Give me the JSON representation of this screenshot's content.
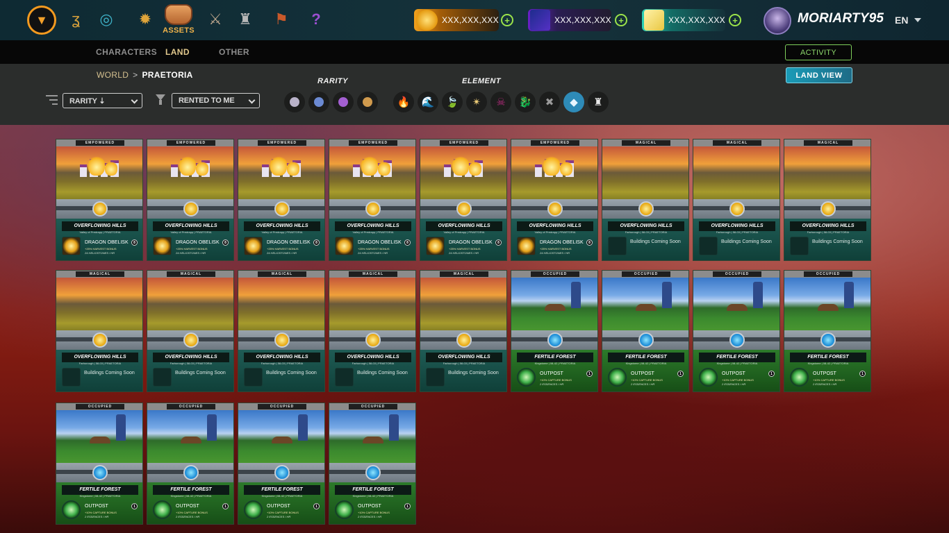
{
  "header": {
    "nav_icons": [
      "battle-icon",
      "scroll-icon",
      "vortex-icon",
      "compass-icon",
      "assets-icon",
      "sword-icon",
      "castle-icon",
      "banner-icon",
      "help-icon"
    ],
    "assets_label": "ASSETS",
    "currencies": [
      {
        "name": "coin",
        "value": "XXX,XXX,XXX",
        "color": "#f0a21b"
      },
      {
        "name": "purple-gem",
        "value": "XXX,XXX,XXX",
        "color": "#7a2ad9"
      },
      {
        "name": "credits",
        "value": "XXX,XXX,XXX",
        "color": "#27b7a9"
      }
    ],
    "username": "MORIARTY95",
    "language": "EN"
  },
  "tabs": [
    {
      "label": "CHARACTERS",
      "active": false
    },
    {
      "label": "LAND",
      "active": true
    },
    {
      "label": "OTHER",
      "active": false
    }
  ],
  "activity_label": "ACTIVITY",
  "breadcrumb": {
    "root": "WORLD",
    "separator": ">",
    "current": "PRAETORIA"
  },
  "land_view_label": "LAND VIEW",
  "filters": {
    "sort_value": "RARITY ⇣",
    "ownership_value": "RENTED TO ME",
    "rarity_label": "RARITY",
    "element_label": "ELEMENT",
    "rarity_colors": [
      "#b9b2c9",
      "#6b8ad3",
      "#a35fd1",
      "#d09a4d"
    ],
    "element_glyphs": [
      {
        "name": "fire-element-icon",
        "glyph": "🔥",
        "active": false
      },
      {
        "name": "water-element-icon",
        "glyph": "🌊",
        "active": false
      },
      {
        "name": "earth-element-icon",
        "glyph": "🍃",
        "active": false
      },
      {
        "name": "life-element-icon",
        "glyph": "✴",
        "active": false
      },
      {
        "name": "death-element-icon",
        "glyph": "☠",
        "active": false
      },
      {
        "name": "dragon-element-icon",
        "glyph": "🐉",
        "active": false
      },
      {
        "name": "neutral-element-icon",
        "glyph": "✖",
        "active": false
      },
      {
        "name": "all-element-icon",
        "glyph": "◆",
        "active": true
      },
      {
        "name": "land-element-icon",
        "glyph": "♜",
        "active": false
      }
    ]
  },
  "cards": [
    {
      "status": "EMPOWERED",
      "terrain": "hills",
      "name": "OVERFLOWING HILLS",
      "sub": "Valley of Predrapp | PRAETORIA",
      "building": "DRAGON OBELISK",
      "bonus": "+25% HARVEST BONUS",
      "rate": "24 HELIOSTONES / HR",
      "badge": "8",
      "kind": "obelisk"
    },
    {
      "status": "EMPOWERED",
      "terrain": "hills",
      "name": "OVERFLOWING HILLS",
      "sub": "Valley of Predrapp | PRAETORIA",
      "building": "DRAGON OBELISK",
      "bonus": "+25% HARVEST BONUS",
      "rate": "24 HELIOSTONES / HR",
      "badge": "8",
      "kind": "obelisk"
    },
    {
      "status": "EMPOWERED",
      "terrain": "hills",
      "name": "OVERFLOWING HILLS",
      "sub": "Valley of Predrapp | PRAETORIA",
      "building": "DRAGON OBELISK",
      "bonus": "+25% HARVEST BONUS",
      "rate": "24 HELIOSTONES / HR",
      "badge": "8",
      "kind": "obelisk"
    },
    {
      "status": "EMPOWERED",
      "terrain": "hills",
      "name": "OVERFLOWING HILLS",
      "sub": "Valley of Predrapp | PRAETORIA",
      "building": "DRAGON OBELISK",
      "bonus": "+25% HARVEST BONUS",
      "rate": "24 HELIOSTONES / HR",
      "badge": "8",
      "kind": "obelisk"
    },
    {
      "status": "EMPOWERED",
      "terrain": "hills",
      "name": "OVERFLOWING HILLS",
      "sub": "Valley of Predrapp | PRAETORIA",
      "building": "DRAGON OBELISK",
      "bonus": "+25% HARVEST BONUS",
      "rate": "24 HELIOSTONES / HR",
      "badge": "8",
      "kind": "obelisk"
    },
    {
      "status": "EMPOWERED",
      "terrain": "hills",
      "name": "OVERFLOWING HILLS",
      "sub": "Valley of Predrapp | PRAETORIA",
      "building": "DRAGON OBELISK",
      "bonus": "+25% HARVEST BONUS",
      "rate": "24 HELIOSTONES / HR",
      "badge": "8",
      "kind": "obelisk"
    },
    {
      "status": "MAGICAL",
      "terrain": "hills",
      "name": "OVERFLOWING HILLS",
      "sub": "Farborough | 58-03 | PRAETORIA",
      "soon": "Buildings Coming Soon",
      "kind": "empty"
    },
    {
      "status": "MAGICAL",
      "terrain": "hills",
      "name": "OVERFLOWING HILLS",
      "sub": "Farborough | 58-03 | PRAETORIA",
      "soon": "Buildings Coming Soon",
      "kind": "empty"
    },
    {
      "status": "MAGICAL",
      "terrain": "hills",
      "name": "OVERFLOWING HILLS",
      "sub": "Farborough | 58-03 | PRAETORIA",
      "soon": "Buildings Coming Soon",
      "kind": "empty"
    },
    {
      "status": "MAGICAL",
      "terrain": "hills",
      "name": "OVERFLOWING HILLS",
      "sub": "Farborough | 58-03 | PRAETORIA",
      "soon": "Buildings Coming Soon",
      "kind": "empty"
    },
    {
      "status": "MAGICAL",
      "terrain": "hills",
      "name": "OVERFLOWING HILLS",
      "sub": "Farborough | 58-03 | PRAETORIA",
      "soon": "Buildings Coming Soon",
      "kind": "empty"
    },
    {
      "status": "MAGICAL",
      "terrain": "hills",
      "name": "OVERFLOWING HILLS",
      "sub": "Farborough | 58-03 | PRAETORIA",
      "soon": "Buildings Coming Soon",
      "kind": "empty"
    },
    {
      "status": "MAGICAL",
      "terrain": "hills",
      "name": "OVERFLOWING HILLS",
      "sub": "Farborough | 58-03 | PRAETORIA",
      "soon": "Buildings Coming Soon",
      "kind": "empty"
    },
    {
      "status": "MAGICAL",
      "terrain": "hills",
      "name": "OVERFLOWING HILLS",
      "sub": "Farborough | 58-03 | PRAETORIA",
      "soon": "Buildings Coming Soon",
      "kind": "empty"
    },
    {
      "status": "OCCUPIED",
      "terrain": "forest",
      "name": "FERTILE FOREST",
      "sub": "Kingstome | 08-42 | PRAETORIA",
      "building": "OUTPOST",
      "bonus": "+10% CAPTURE BONUS",
      "rate": "2 ESSENCES / HR",
      "badge": "1",
      "kind": "outpost"
    },
    {
      "status": "OCCUPIED",
      "terrain": "forest",
      "name": "FERTILE FOREST",
      "sub": "Kingstome | 08-42 | PRAETORIA",
      "building": "OUTPOST",
      "bonus": "+10% CAPTURE BONUS",
      "rate": "2 ESSENCES / HR",
      "badge": "1",
      "kind": "outpost"
    },
    {
      "status": "OCCUPIED",
      "terrain": "forest",
      "name": "FERTILE FOREST",
      "sub": "Kingstome | 08-42 | PRAETORIA",
      "building": "OUTPOST",
      "bonus": "+10% CAPTURE BONUS",
      "rate": "2 ESSENCES / HR",
      "badge": "1",
      "kind": "outpost"
    },
    {
      "status": "OCCUPIED",
      "terrain": "forest",
      "name": "FERTILE FOREST",
      "sub": "Kingstome | 08-42 | PRAETORIA",
      "building": "OUTPOST",
      "bonus": "+10% CAPTURE BONUS",
      "rate": "2 ESSENCES / HR",
      "badge": "1",
      "kind": "outpost"
    },
    {
      "status": "OCCUPIED",
      "terrain": "forest",
      "name": "FERTILE FOREST",
      "sub": "Kingstome | 08-42 | PRAETORIA",
      "building": "OUTPOST",
      "bonus": "+10% CAPTURE BONUS",
      "rate": "2 ESSENCES / HR",
      "badge": "1",
      "kind": "outpost"
    },
    {
      "status": "OCCUPIED",
      "terrain": "forest",
      "name": "FERTILE FOREST",
      "sub": "Kingstome | 08-42 | PRAETORIA",
      "building": "OUTPOST",
      "bonus": "+10% CAPTURE BONUS",
      "rate": "2 ESSENCES / HR",
      "badge": "1",
      "kind": "outpost"
    },
    {
      "status": "OCCUPIED",
      "terrain": "forest",
      "name": "FERTILE FOREST",
      "sub": "Kingstome | 08-42 | PRAETORIA",
      "building": "OUTPOST",
      "bonus": "+10% CAPTURE BONUS",
      "rate": "2 ESSENCES / HR",
      "badge": "1",
      "kind": "outpost"
    },
    {
      "status": "OCCUPIED",
      "terrain": "forest",
      "name": "FERTILE FOREST",
      "sub": "Kingstome | 08-42 | PRAETORIA",
      "building": "OUTPOST",
      "bonus": "+10% CAPTURE BONUS",
      "rate": "2 ESSENCES / HR",
      "badge": "1",
      "kind": "outpost"
    }
  ]
}
